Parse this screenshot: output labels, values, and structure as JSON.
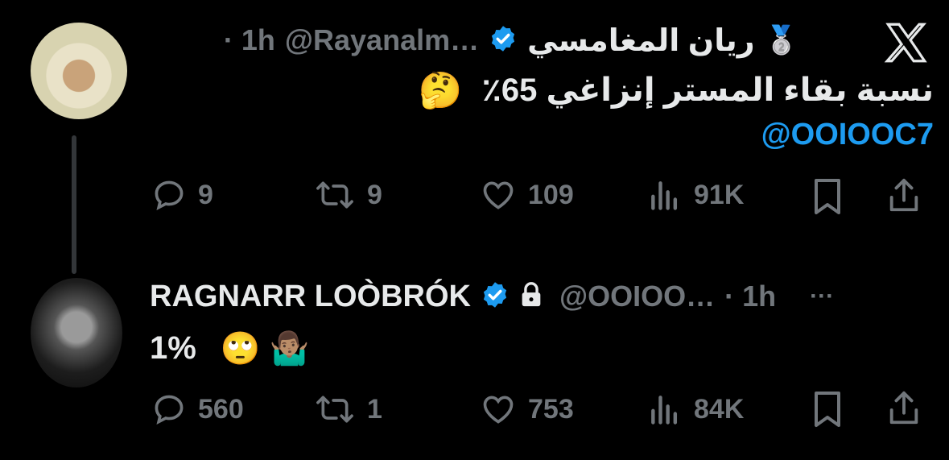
{
  "tweet1": {
    "display_name": "ريان المغامسي",
    "handle": "@Rayanalm…",
    "time": "· 1h",
    "text": "نسبة بقاء المستر إنزاغي 65٪",
    "emoji": "🤔",
    "badge_emoji": "🥈",
    "mention": "@OOIOOC7",
    "stats": {
      "replies": "9",
      "reposts": "9",
      "likes": "109",
      "views": "91K"
    }
  },
  "tweet2": {
    "display_name": "RAGNARR LOÒBRÓK",
    "handle": "@OOIOO…",
    "time": "· 1h",
    "more": "···",
    "text": "1%",
    "emojis": "🙄 🤷🏽‍♂️",
    "stats": {
      "replies": "560",
      "reposts": "1",
      "likes": "753",
      "views": "84K"
    }
  },
  "colors": {
    "background": "#000000",
    "text": "#e7e9ea",
    "muted": "#71767b",
    "accent": "#1d9bf0"
  }
}
